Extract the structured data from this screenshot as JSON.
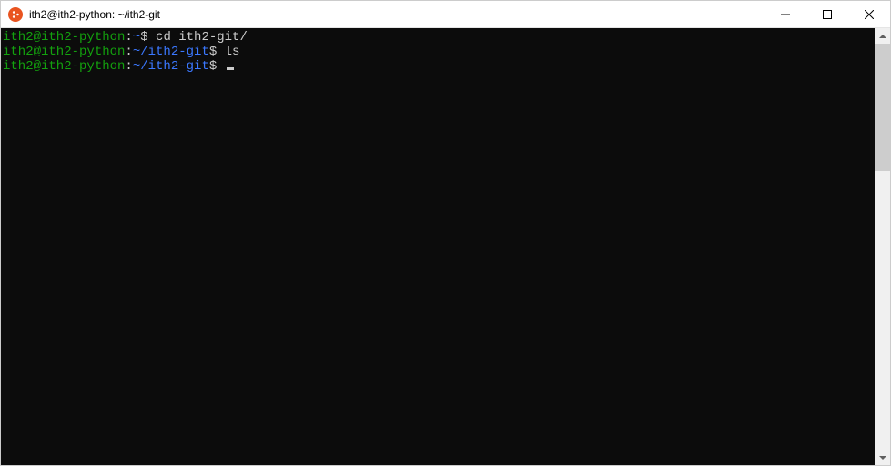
{
  "window": {
    "title": "ith2@ith2-python: ~/ith2-git"
  },
  "terminal": {
    "lines": [
      {
        "user_host": "ith2@ith2-python",
        "sep": ":",
        "path": "~",
        "prompt": "$ ",
        "command": "cd ith2-git/"
      },
      {
        "user_host": "ith2@ith2-python",
        "sep": ":",
        "path": "~/ith2-git",
        "prompt": "$ ",
        "command": "ls"
      },
      {
        "user_host": "ith2@ith2-python",
        "sep": ":",
        "path": "~/ith2-git",
        "prompt": "$ ",
        "command": ""
      }
    ]
  },
  "colors": {
    "terminal_bg": "#0c0c0c",
    "prompt_user": "#13a10e",
    "prompt_path": "#3b78ff",
    "text": "#cccccc",
    "accent": "#E95420"
  }
}
